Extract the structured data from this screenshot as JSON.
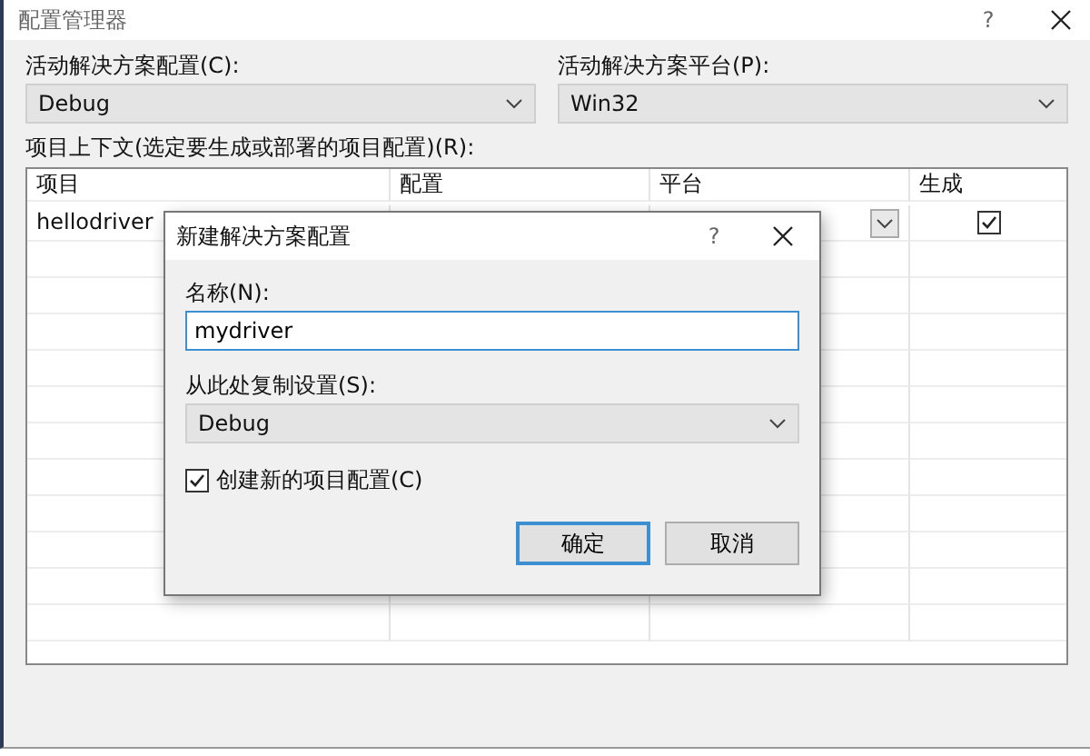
{
  "window": {
    "title": "配置管理器",
    "help": "?"
  },
  "active_config": {
    "label": "活动解决方案配置(C):",
    "value": "Debug"
  },
  "active_platform": {
    "label": "活动解决方案平台(P):",
    "value": "Win32"
  },
  "context_label": "项目上下文(选定要生成或部署的项目配置)(R):",
  "table": {
    "columns": [
      "项目",
      "配置",
      "平台",
      "生成"
    ],
    "rows": [
      {
        "project": "hellodriver",
        "build": true
      }
    ]
  },
  "dialog": {
    "title": "新建解决方案配置",
    "help": "?",
    "name_label": "名称(N):",
    "name_value": "mydriver",
    "copy_label": "从此处复制设置(S):",
    "copy_value": "Debug",
    "create_project": {
      "label": "创建新的项目配置(C)",
      "checked": true
    },
    "buttons": [
      {
        "label": "确定",
        "selected": true
      },
      {
        "label": "取消",
        "selected": false
      }
    ]
  }
}
